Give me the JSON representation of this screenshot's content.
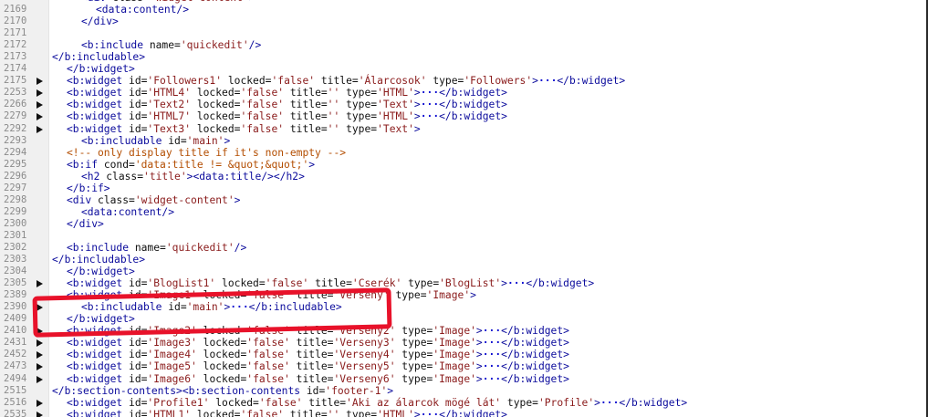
{
  "editor": {
    "lines": [
      {
        "num": "2168",
        "fold": false,
        "indent": 2,
        "tokens": [
          [
            "tag",
            "<div "
          ],
          [
            "an",
            "class="
          ],
          [
            "av",
            "'widget-content'"
          ],
          [
            "tag",
            ">"
          ]
        ]
      },
      {
        "num": "2169",
        "fold": false,
        "indent": 3,
        "tokens": [
          [
            "tag",
            "<data:content/>"
          ]
        ]
      },
      {
        "num": "2170",
        "fold": false,
        "indent": 2,
        "tokens": [
          [
            "tag",
            "</div>"
          ]
        ]
      },
      {
        "num": "2171",
        "fold": false,
        "indent": 0,
        "tokens": []
      },
      {
        "num": "2172",
        "fold": false,
        "indent": 2,
        "tokens": [
          [
            "tag",
            "<b:include "
          ],
          [
            "an",
            "name="
          ],
          [
            "av",
            "'quickedit'"
          ],
          [
            "tag",
            "/>"
          ]
        ]
      },
      {
        "num": "2173",
        "fold": false,
        "indent": 0,
        "tokens": [
          [
            "tag",
            "</b:includable>"
          ]
        ]
      },
      {
        "num": "2174",
        "fold": false,
        "indent": 1,
        "tokens": [
          [
            "tag",
            "</b:widget>"
          ]
        ]
      },
      {
        "num": "2175",
        "fold": true,
        "indent": 1,
        "tokens": [
          [
            "tag",
            "<b:widget "
          ],
          [
            "an",
            "id="
          ],
          [
            "av",
            "'Followers1'"
          ],
          [
            "an",
            " locked="
          ],
          [
            "av",
            "'false'"
          ],
          [
            "an",
            " title="
          ],
          [
            "av",
            "'Álarcosok'"
          ],
          [
            "an",
            " type="
          ],
          [
            "av",
            "'Followers'"
          ],
          [
            "tag",
            ">"
          ],
          [
            "ell",
            "···"
          ],
          [
            "tag",
            "</b:widget>"
          ]
        ]
      },
      {
        "num": "2253",
        "fold": true,
        "indent": 1,
        "tokens": [
          [
            "tag",
            "<b:widget "
          ],
          [
            "an",
            "id="
          ],
          [
            "av",
            "'HTML4'"
          ],
          [
            "an",
            " locked="
          ],
          [
            "av",
            "'false'"
          ],
          [
            "an",
            " title="
          ],
          [
            "av",
            "''"
          ],
          [
            "an",
            " type="
          ],
          [
            "av",
            "'HTML'"
          ],
          [
            "tag",
            ">"
          ],
          [
            "ell",
            "···"
          ],
          [
            "tag",
            "</b:widget>"
          ]
        ]
      },
      {
        "num": "2266",
        "fold": true,
        "indent": 1,
        "tokens": [
          [
            "tag",
            "<b:widget "
          ],
          [
            "an",
            "id="
          ],
          [
            "av",
            "'Text2'"
          ],
          [
            "an",
            " locked="
          ],
          [
            "av",
            "'false'"
          ],
          [
            "an",
            " title="
          ],
          [
            "av",
            "''"
          ],
          [
            "an",
            " type="
          ],
          [
            "av",
            "'Text'"
          ],
          [
            "tag",
            ">"
          ],
          [
            "ell",
            "···"
          ],
          [
            "tag",
            "</b:widget>"
          ]
        ]
      },
      {
        "num": "2279",
        "fold": true,
        "indent": 1,
        "tokens": [
          [
            "tag",
            "<b:widget "
          ],
          [
            "an",
            "id="
          ],
          [
            "av",
            "'HTML7'"
          ],
          [
            "an",
            " locked="
          ],
          [
            "av",
            "'false'"
          ],
          [
            "an",
            " title="
          ],
          [
            "av",
            "''"
          ],
          [
            "an",
            " type="
          ],
          [
            "av",
            "'HTML'"
          ],
          [
            "tag",
            ">"
          ],
          [
            "ell",
            "···"
          ],
          [
            "tag",
            "</b:widget>"
          ]
        ]
      },
      {
        "num": "2292",
        "fold": true,
        "indent": 1,
        "tokens": [
          [
            "tag",
            "<b:widget "
          ],
          [
            "an",
            "id="
          ],
          [
            "av",
            "'Text3'"
          ],
          [
            "an",
            " locked="
          ],
          [
            "av",
            "'false'"
          ],
          [
            "an",
            " title="
          ],
          [
            "av",
            "''"
          ],
          [
            "an",
            " type="
          ],
          [
            "av",
            "'Text'"
          ],
          [
            "tag",
            ">"
          ]
        ]
      },
      {
        "num": "2293",
        "fold": false,
        "indent": 2,
        "tokens": [
          [
            "tag",
            "<b:includable "
          ],
          [
            "an",
            "id="
          ],
          [
            "av",
            "'main'"
          ],
          [
            "tag",
            ">"
          ]
        ]
      },
      {
        "num": "2294",
        "fold": false,
        "indent": 1,
        "tokens": [
          [
            "cm",
            "<!-- only display title if it's non-empty -->"
          ]
        ]
      },
      {
        "num": "2295",
        "fold": false,
        "indent": 1,
        "tokens": [
          [
            "tag",
            "<b:if "
          ],
          [
            "an",
            "cond="
          ],
          [
            "cm",
            "'data:title != &quot;&quot;'"
          ],
          [
            "tag",
            ">"
          ]
        ]
      },
      {
        "num": "2296",
        "fold": false,
        "indent": 2,
        "tokens": [
          [
            "tag",
            "<h2 "
          ],
          [
            "an",
            "class="
          ],
          [
            "av",
            "'title'"
          ],
          [
            "tag",
            "><data:title/></h2>"
          ]
        ]
      },
      {
        "num": "2297",
        "fold": false,
        "indent": 1,
        "tokens": [
          [
            "tag",
            "</b:if>"
          ]
        ]
      },
      {
        "num": "2298",
        "fold": false,
        "indent": 1,
        "tokens": [
          [
            "tag",
            "<div "
          ],
          [
            "an",
            "class="
          ],
          [
            "av",
            "'widget-content'"
          ],
          [
            "tag",
            ">"
          ]
        ]
      },
      {
        "num": "2299",
        "fold": false,
        "indent": 2,
        "tokens": [
          [
            "tag",
            "<data:content/>"
          ]
        ]
      },
      {
        "num": "2300",
        "fold": false,
        "indent": 1,
        "tokens": [
          [
            "tag",
            "</div>"
          ]
        ]
      },
      {
        "num": "2301",
        "fold": false,
        "indent": 0,
        "tokens": []
      },
      {
        "num": "2302",
        "fold": false,
        "indent": 1,
        "tokens": [
          [
            "tag",
            "<b:include "
          ],
          [
            "an",
            "name="
          ],
          [
            "av",
            "'quickedit'"
          ],
          [
            "tag",
            "/>"
          ]
        ]
      },
      {
        "num": "2303",
        "fold": false,
        "indent": 0,
        "tokens": [
          [
            "tag",
            "</b:includable>"
          ]
        ]
      },
      {
        "num": "2304",
        "fold": false,
        "indent": 1,
        "tokens": [
          [
            "tag",
            "</b:widget>"
          ]
        ]
      },
      {
        "num": "2305",
        "fold": true,
        "indent": 1,
        "tokens": [
          [
            "tag",
            "<b:widget "
          ],
          [
            "an",
            "id="
          ],
          [
            "av",
            "'BlogList1'"
          ],
          [
            "an",
            " locked="
          ],
          [
            "av",
            "'false'"
          ],
          [
            "an",
            " title="
          ],
          [
            "av",
            "'Cserék'"
          ],
          [
            "an",
            " type="
          ],
          [
            "av",
            "'BlogList'"
          ],
          [
            "tag",
            ">"
          ],
          [
            "ell",
            "···"
          ],
          [
            "tag",
            "</b:widget>"
          ]
        ]
      },
      {
        "num": "2389",
        "fold": false,
        "indent": 1,
        "tokens": [
          [
            "tag",
            "<b:widget "
          ],
          [
            "an",
            "id="
          ],
          [
            "av",
            "'Image1'"
          ],
          [
            "an",
            " locked="
          ],
          [
            "av",
            "'false'"
          ],
          [
            "an",
            " title="
          ],
          [
            "av",
            "'Verseny'"
          ],
          [
            "an",
            " type="
          ],
          [
            "av",
            "'Image'"
          ],
          [
            "tag",
            ">"
          ]
        ]
      },
      {
        "num": "2390",
        "fold": true,
        "indent": 2,
        "tokens": [
          [
            "tag",
            "<b:includable "
          ],
          [
            "an",
            "id="
          ],
          [
            "av",
            "'main'"
          ],
          [
            "tag",
            ">"
          ],
          [
            "ell",
            "···"
          ],
          [
            "tag",
            "</b:includable>"
          ]
        ]
      },
      {
        "num": "2409",
        "fold": false,
        "indent": 1,
        "tokens": [
          [
            "tag",
            "</b:widget>"
          ]
        ]
      },
      {
        "num": "2410",
        "fold": true,
        "indent": 1,
        "tokens": [
          [
            "tag",
            "<b:widget "
          ],
          [
            "an",
            "id="
          ],
          [
            "av",
            "'Image2'"
          ],
          [
            "an",
            " locked="
          ],
          [
            "av",
            "'false'"
          ],
          [
            "an",
            " title="
          ],
          [
            "av",
            "'Verseny2'"
          ],
          [
            "an",
            " type="
          ],
          [
            "av",
            "'Image'"
          ],
          [
            "tag",
            ">"
          ],
          [
            "ell",
            "···"
          ],
          [
            "tag",
            "</b:widget>"
          ]
        ]
      },
      {
        "num": "2431",
        "fold": true,
        "indent": 1,
        "tokens": [
          [
            "tag",
            "<b:widget "
          ],
          [
            "an",
            "id="
          ],
          [
            "av",
            "'Image3'"
          ],
          [
            "an",
            " locked="
          ],
          [
            "av",
            "'false'"
          ],
          [
            "an",
            " title="
          ],
          [
            "av",
            "'Verseny3'"
          ],
          [
            "an",
            " type="
          ],
          [
            "av",
            "'Image'"
          ],
          [
            "tag",
            ">"
          ],
          [
            "ell",
            "···"
          ],
          [
            "tag",
            "</b:widget>"
          ]
        ]
      },
      {
        "num": "2452",
        "fold": true,
        "indent": 1,
        "tokens": [
          [
            "tag",
            "<b:widget "
          ],
          [
            "an",
            "id="
          ],
          [
            "av",
            "'Image4'"
          ],
          [
            "an",
            " locked="
          ],
          [
            "av",
            "'false'"
          ],
          [
            "an",
            " title="
          ],
          [
            "av",
            "'Verseny4'"
          ],
          [
            "an",
            " type="
          ],
          [
            "av",
            "'Image'"
          ],
          [
            "tag",
            ">"
          ],
          [
            "ell",
            "···"
          ],
          [
            "tag",
            "</b:widget>"
          ]
        ]
      },
      {
        "num": "2473",
        "fold": true,
        "indent": 1,
        "tokens": [
          [
            "tag",
            "<b:widget "
          ],
          [
            "an",
            "id="
          ],
          [
            "av",
            "'Image5'"
          ],
          [
            "an",
            " locked="
          ],
          [
            "av",
            "'false'"
          ],
          [
            "an",
            " title="
          ],
          [
            "av",
            "'Verseny5'"
          ],
          [
            "an",
            " type="
          ],
          [
            "av",
            "'Image'"
          ],
          [
            "tag",
            ">"
          ],
          [
            "ell",
            "···"
          ],
          [
            "tag",
            "</b:widget>"
          ]
        ]
      },
      {
        "num": "2494",
        "fold": true,
        "indent": 1,
        "tokens": [
          [
            "tag",
            "<b:widget "
          ],
          [
            "an",
            "id="
          ],
          [
            "av",
            "'Image6'"
          ],
          [
            "an",
            " locked="
          ],
          [
            "av",
            "'false'"
          ],
          [
            "an",
            " title="
          ],
          [
            "av",
            "'Verseny6'"
          ],
          [
            "an",
            " type="
          ],
          [
            "av",
            "'Image'"
          ],
          [
            "tag",
            ">"
          ],
          [
            "ell",
            "···"
          ],
          [
            "tag",
            "</b:widget>"
          ]
        ]
      },
      {
        "num": "2515",
        "fold": false,
        "indent": 0,
        "tokens": [
          [
            "tag",
            "</b:section-contents><b:section-contents "
          ],
          [
            "an",
            "id="
          ],
          [
            "av",
            "'footer-1'"
          ],
          [
            "tag",
            ">"
          ]
        ]
      },
      {
        "num": "2516",
        "fold": true,
        "indent": 1,
        "tokens": [
          [
            "tag",
            "<b:widget "
          ],
          [
            "an",
            "id="
          ],
          [
            "av",
            "'Profile1'"
          ],
          [
            "an",
            " locked="
          ],
          [
            "av",
            "'false'"
          ],
          [
            "an",
            " title="
          ],
          [
            "av",
            "'Aki az álarcok mögé lát'"
          ],
          [
            "an",
            " type="
          ],
          [
            "av",
            "'Profile'"
          ],
          [
            "tag",
            ">"
          ],
          [
            "ell",
            "···"
          ],
          [
            "tag",
            "</b:widget>"
          ]
        ]
      },
      {
        "num": "2535",
        "fold": true,
        "indent": 1,
        "tokens": [
          [
            "tag",
            "<b:widget "
          ],
          [
            "an",
            "id="
          ],
          [
            "av",
            "'HTML1'"
          ],
          [
            "an",
            " locked="
          ],
          [
            "av",
            "'false'"
          ],
          [
            "an",
            " title="
          ],
          [
            "av",
            "''"
          ],
          [
            "an",
            " type="
          ],
          [
            "av",
            "'HTML'"
          ],
          [
            "tag",
            ">"
          ],
          [
            "ell",
            "···"
          ],
          [
            "tag",
            "</b:widget>"
          ]
        ]
      }
    ]
  },
  "annotation": {
    "color": "#e8122a"
  }
}
